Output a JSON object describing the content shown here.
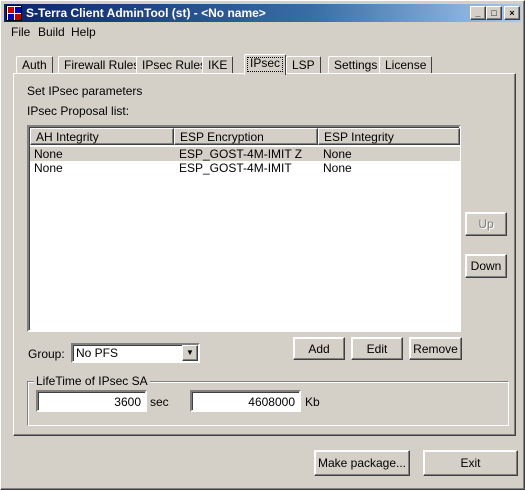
{
  "window": {
    "title": "S-Terra Client AdminTool (st) - <No name>",
    "minimize": "_",
    "maximize": "□",
    "close": "×"
  },
  "menu": [
    "File",
    "Build",
    "Help"
  ],
  "tabs": [
    "Auth",
    "Firewall Rules",
    "IPsec Rules",
    "IKE",
    "IPsec",
    "LSP",
    "Settings",
    "License"
  ],
  "active_tab": "IPsec",
  "panel": {
    "heading": "Set IPsec parameters",
    "list_label": "IPsec Proposal list:",
    "columns": [
      "AH Integrity",
      "ESP Encryption",
      "ESP Integrity"
    ],
    "rows": [
      [
        "None",
        "ESP_GOST-4M-IMIT Z",
        "None"
      ],
      [
        "None",
        "ESP_GOST-4M-IMIT",
        "None"
      ]
    ],
    "up_button": "Up",
    "down_button": "Down",
    "group_label": "Group:",
    "group_value": "No PFS",
    "add_button": "Add",
    "edit_button": "Edit",
    "remove_button": "Remove",
    "lifetime_title": "LifeTime of IPsec SA",
    "lifetime_sec": "3600",
    "sec_unit": "sec",
    "lifetime_kb": "4608000",
    "kb_unit": "Kb"
  },
  "footer": {
    "make_package": "Make package...",
    "exit": "Exit"
  }
}
